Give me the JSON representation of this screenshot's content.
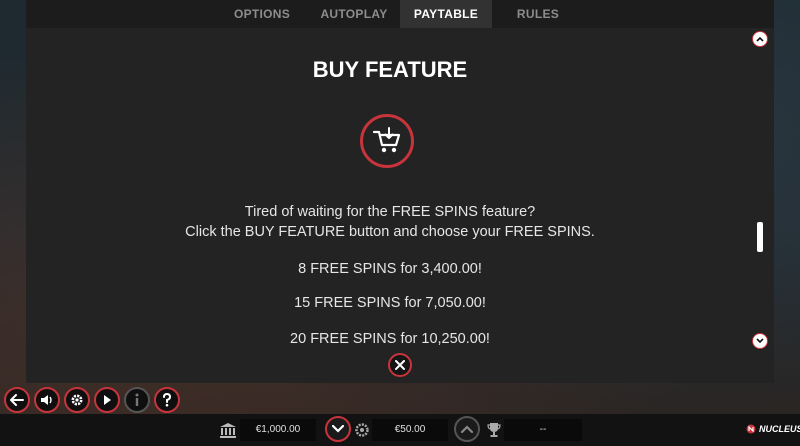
{
  "tabs": [
    {
      "label": "OPTIONS"
    },
    {
      "label": "AUTOPLAY"
    },
    {
      "label": "PAYTABLE",
      "active": true
    },
    {
      "label": "RULES"
    }
  ],
  "section": {
    "title": "BUY FEATURE",
    "icon": "cart-download-icon",
    "line1": "Tired of waiting for the FREE SPINS feature?",
    "line2": "Click the BUY FEATURE button and choose your FREE SPINS.",
    "offers": [
      "8 FREE SPINS for 3,400.00!",
      "15 FREE SPINS for 7,050.00!",
      "20 FREE SPINS for 10,250.00!"
    ]
  },
  "bottom": {
    "balance": "€1,000.00",
    "bet": "€50.00",
    "win": "--",
    "brand": "NUCLEUS"
  },
  "colors": {
    "accent": "#c8343c",
    "panel": "#232323",
    "tab_bar": "#1c1c1c"
  }
}
